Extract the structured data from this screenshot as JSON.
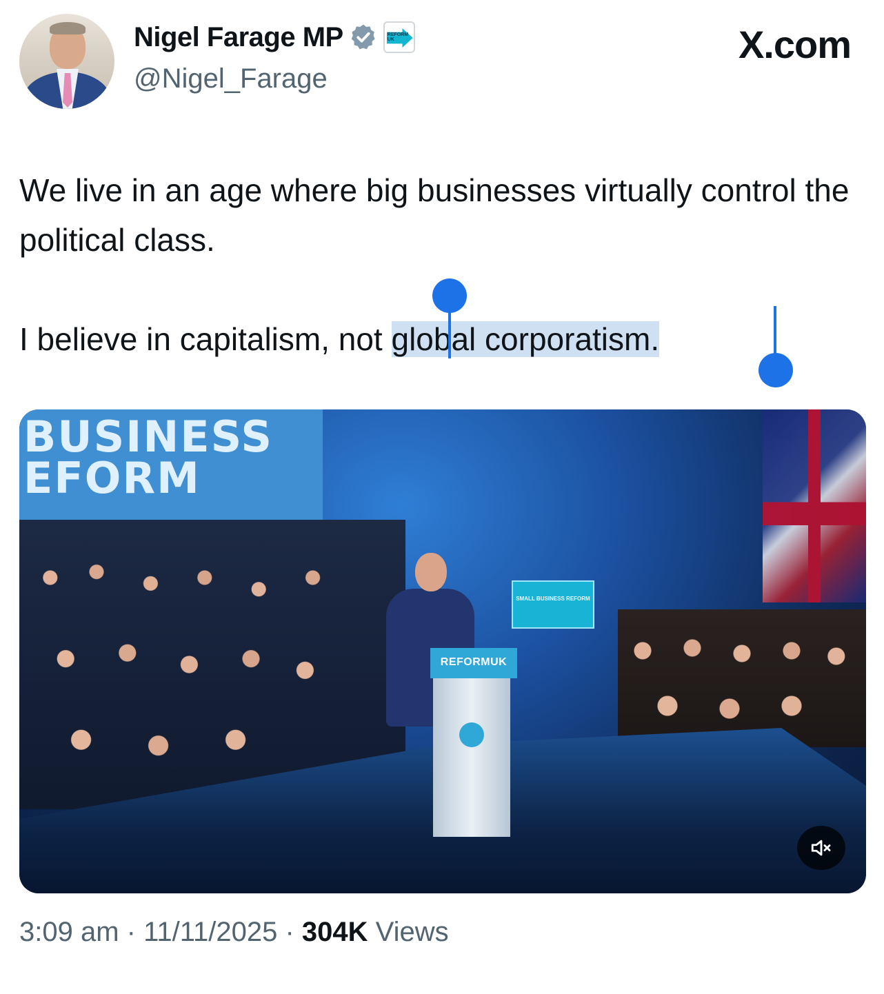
{
  "author": {
    "name": "Nigel Farage MP",
    "handle": "@Nigel_Farage",
    "affiliate_badge_text": "REFORM UK",
    "verified_color": "#829aab"
  },
  "brand": "X.com",
  "tweet": {
    "paragraphs": [
      "We live in an age where big businesses virtually control the political class.",
      "I believe in capitalism, not global corporatism."
    ],
    "para2_before": "I believe in capitalism, not",
    "para2_selected": "global corporatism."
  },
  "media": {
    "banner_line1": "BUSINESS",
    "banner_line2": "EFORM",
    "screen_text": "SMALL BUSINESS REFORM",
    "podium_text": "REFORMUK",
    "mute_icon": "speaker-muted-icon"
  },
  "meta": {
    "time": "3:09 am",
    "sep1": " · ",
    "date": "11/11/2025",
    "sep2": " · ",
    "views_count": "304K",
    "views_label": " Views"
  },
  "colors": {
    "selection": "#cfe0f3",
    "handle": "#1d72e8",
    "secondary_text": "#536471"
  }
}
